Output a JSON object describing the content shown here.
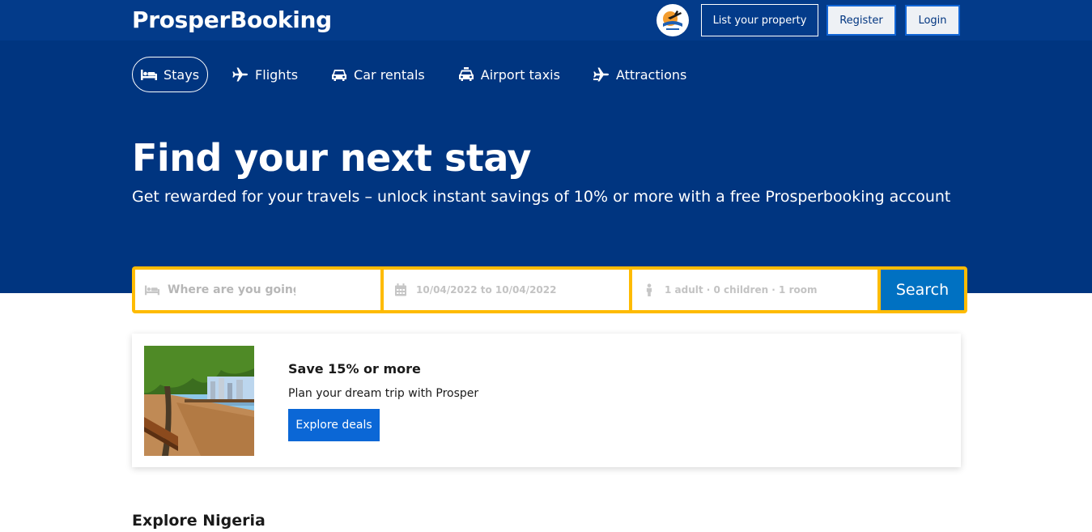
{
  "header": {
    "brand": "ProsperBooking",
    "list_property": "List your property",
    "register": "Register",
    "login": "Login"
  },
  "nav": {
    "items": [
      {
        "label": "Stays",
        "icon": "bed-icon"
      },
      {
        "label": "Flights",
        "icon": "plane-icon"
      },
      {
        "label": "Car rentals",
        "icon": "car-icon"
      },
      {
        "label": "Airport taxis",
        "icon": "taxi-icon"
      },
      {
        "label": "Attractions",
        "icon": "attractions-icon"
      }
    ]
  },
  "hero": {
    "title": "Find your next stay",
    "subtitle": "Get rewarded for your travels – unlock instant savings of 10% or more with a free Prosperbooking account"
  },
  "search": {
    "destination_placeholder": "Where are you going?",
    "dates": "10/04/2022 to 10/04/2022",
    "guests": "1 adult · 0 children · 1 room",
    "button": "Search"
  },
  "promo": {
    "title": "Save 15% or more",
    "subtitle": "Plan your dream trip with Prosper",
    "button": "Explore deals"
  },
  "explore": {
    "title": "Explore Nigeria"
  },
  "colors": {
    "hero": "#003580",
    "topbar": "#033b8a",
    "search_border": "#febb02",
    "search_button": "#0071c2"
  }
}
